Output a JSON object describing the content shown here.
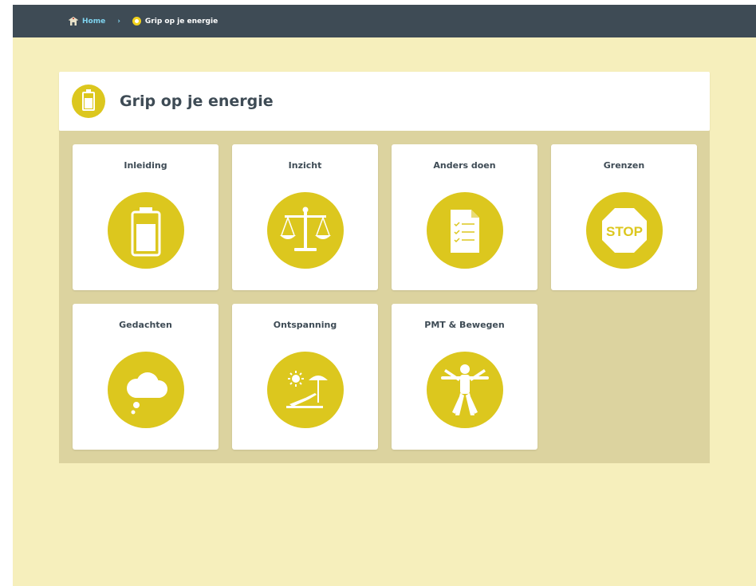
{
  "breadcrumb": {
    "home_label": "Home",
    "separator": "›",
    "current_label": "Grip op je energie"
  },
  "header": {
    "title": "Grip op je energie",
    "icon": "battery-icon"
  },
  "colors": {
    "topbar": "#3e4b55",
    "background": "#f6efbc",
    "panel": "#dcd39f",
    "accent": "#dcc71e",
    "link": "#7fd4f0"
  },
  "tiles": [
    {
      "label": "Inleiding",
      "icon": "battery-icon"
    },
    {
      "label": "Inzicht",
      "icon": "scales-icon"
    },
    {
      "label": "Anders doen",
      "icon": "checklist-icon"
    },
    {
      "label": "Grenzen",
      "icon": "stop-sign-icon",
      "icon_text": "STOP"
    },
    {
      "label": "Gedachten",
      "icon": "thought-cloud-icon"
    },
    {
      "label": "Ontspanning",
      "icon": "beach-chair-icon"
    },
    {
      "label": "PMT & Bewegen",
      "icon": "vitruvian-man-icon"
    }
  ]
}
